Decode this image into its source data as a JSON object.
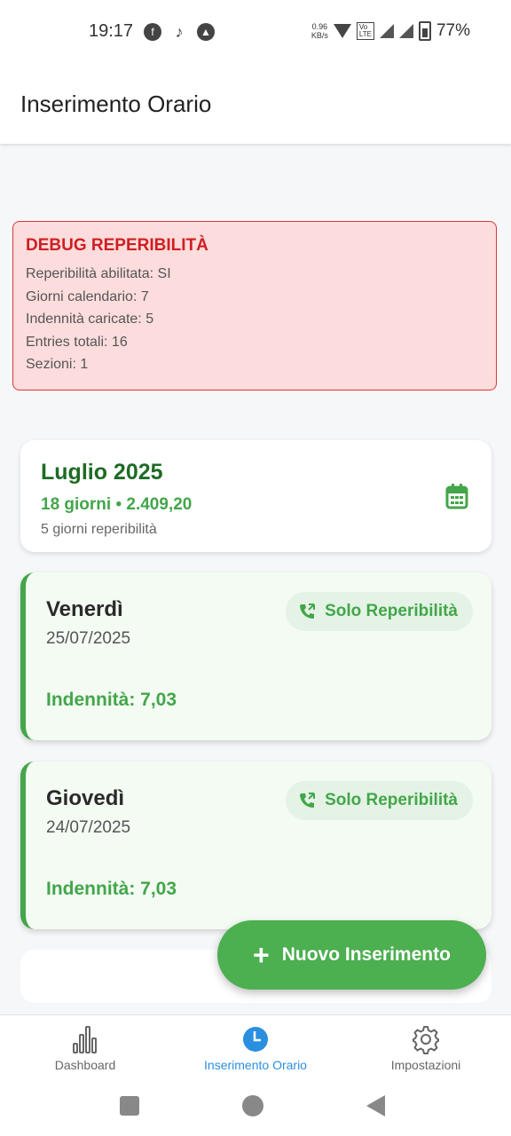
{
  "status_bar": {
    "time": "19:17",
    "net_speed_value": "0.96",
    "net_speed_unit": "KB/s",
    "battery_percent": "77%",
    "app_icons": [
      "facebook-icon",
      "tiktok-icon",
      "app-a-icon"
    ]
  },
  "header": {
    "title": "Inserimento Orario"
  },
  "debug": {
    "title": "DEBUG REPERIBILITÀ",
    "lines": [
      "Reperibilità abilitata: SI",
      "Giorni calendario: 7",
      "Indennità caricate: 5",
      "Entries totali: 16",
      "Sezioni: 1"
    ]
  },
  "month_summary": {
    "title": "Luglio 2025",
    "subtitle": "18 giorni • 2.409,20",
    "note": "5 giorni reperibilità"
  },
  "entries": [
    {
      "day": "Venerdì",
      "date": "25/07/2025",
      "chip": "Solo Reperibilità",
      "indennita": "Indennità: 7,03"
    },
    {
      "day": "Giovedì",
      "date": "24/07/2025",
      "chip": "Solo Reperibilità",
      "indennita": "Indennità: 7,03"
    }
  ],
  "fab": {
    "label": "Nuovo Inserimento"
  },
  "bottom_nav": [
    {
      "label": "Dashboard",
      "icon": "bar-chart-icon",
      "active": false
    },
    {
      "label": "Inserimento Orario",
      "icon": "clock-icon",
      "active": true
    },
    {
      "label": "Impostazioni",
      "icon": "gear-icon",
      "active": false
    }
  ],
  "colors": {
    "accent_green": "#43a64a",
    "dark_green": "#1d6b25",
    "debug_red": "#d01e22",
    "active_blue": "#2b8fe0"
  }
}
